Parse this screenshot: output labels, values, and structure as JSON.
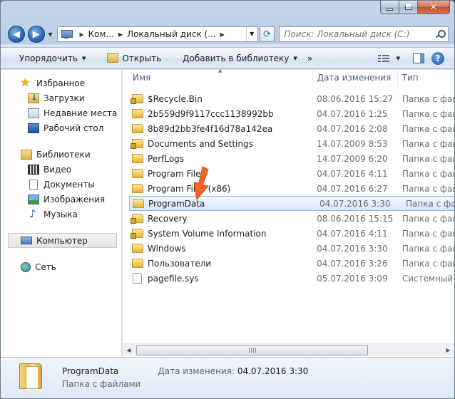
{
  "address": {
    "segments": [
      "Ком...",
      "Локальный диск (..."
    ],
    "search_placeholder": "Поиск: Локальный диск (C:)"
  },
  "toolbar": {
    "organize": "Упорядочить",
    "open": "Открыть",
    "add_to_library": "Добавить в библиотеку",
    "more": "»"
  },
  "columns": {
    "name": "Имя",
    "date": "Дата изменения",
    "type": "Тип"
  },
  "sidebar": {
    "favorites": "Избранное",
    "favorites_items": [
      "Загрузки",
      "Недавние места",
      "Рабочий стол"
    ],
    "libraries": "Библиотеки",
    "libraries_items": [
      "Видео",
      "Документы",
      "Изображения",
      "Музыка"
    ],
    "computer": "Компьютер",
    "network": "Сеть"
  },
  "files": [
    {
      "name": "$Recycle.Bin",
      "date": "08.06.2016 15:27",
      "type": "Папка с файлами",
      "icon": "folder-locked"
    },
    {
      "name": "2b559d9f9117ccc1138992bb",
      "date": "04.07.2016 1:25",
      "type": "Папка с файлами",
      "icon": "folder"
    },
    {
      "name": "8b89d2bb3fe4f16d78a142ea",
      "date": "04.07.2016 2:08",
      "type": "Папка с файлами",
      "icon": "folder"
    },
    {
      "name": "Documents and Settings",
      "date": "14.07.2009 8:53",
      "type": "Папка с файлами",
      "icon": "folder-locked"
    },
    {
      "name": "PerfLogs",
      "date": "14.07.2009 6:20",
      "type": "Папка с файлами",
      "icon": "folder"
    },
    {
      "name": "Program Files",
      "date": "04.07.2016 4:11",
      "type": "Папка с файлами",
      "icon": "folder"
    },
    {
      "name": "Program Files (x86)",
      "date": "04.07.2016 6:27",
      "type": "Папка с файлами",
      "icon": "folder"
    },
    {
      "name": "ProgramData",
      "date": "04.07.2016 3:30",
      "type": "Папка с файлами",
      "icon": "folder"
    },
    {
      "name": "Recovery",
      "date": "08.06.2016 15:15",
      "type": "Папка с файлами",
      "icon": "folder-locked"
    },
    {
      "name": "System Volume Information",
      "date": "04.07.2016 4:11",
      "type": "Папка с файлами",
      "icon": "folder-locked"
    },
    {
      "name": "Windows",
      "date": "04.07.2016 3:30",
      "type": "Папка с файлами",
      "icon": "folder"
    },
    {
      "name": "Пользователи",
      "date": "04.07.2016 3:26",
      "type": "Папка с файлами",
      "icon": "folder"
    },
    {
      "name": "pagefile.sys",
      "date": "05.07.2016 3:09",
      "type": "Системный файл",
      "icon": "file"
    }
  ],
  "selected_index": 7,
  "details": {
    "name": "ProgramData",
    "type": "Папка с файлами",
    "date_label": "Дата изменения:",
    "date_value": "04.07.2016 3:30"
  },
  "colors": {
    "selection_border": "#8fb5e3",
    "arrow": "#f26522"
  }
}
